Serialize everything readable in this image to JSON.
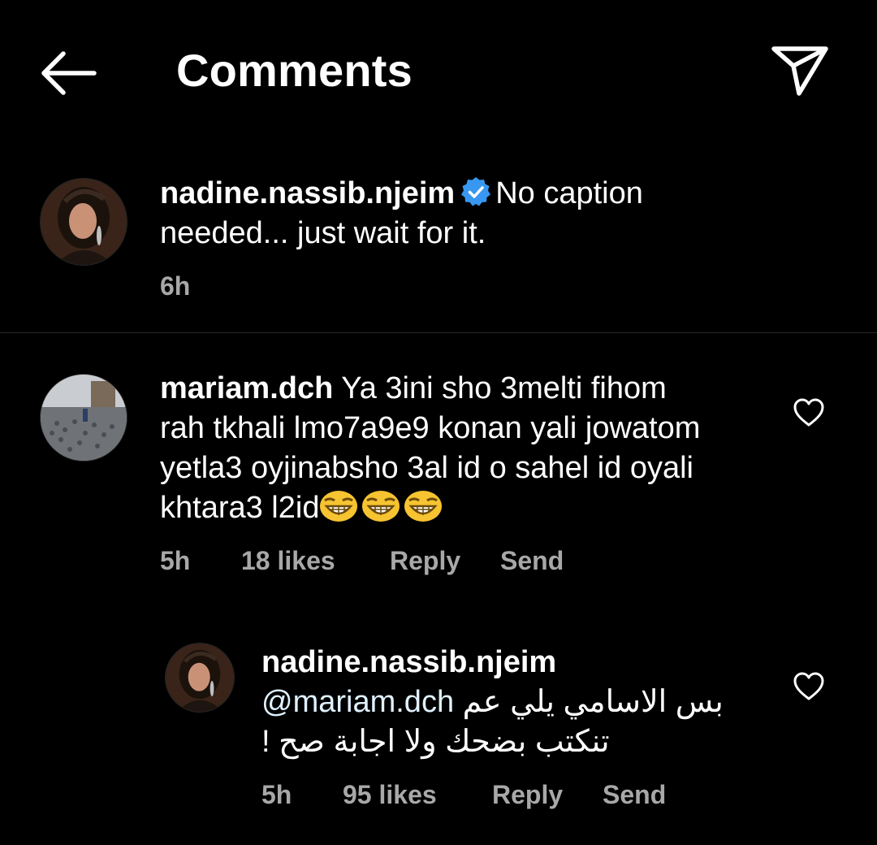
{
  "header": {
    "title": "Comments",
    "back_icon": "arrow-left-icon",
    "share_icon": "paper-plane-icon"
  },
  "caption": {
    "username": "nadine.nassib.njeim",
    "verified": true,
    "text_line1": "No caption",
    "text_line2": "needed... just wait for it.",
    "time": "6h"
  },
  "comments": [
    {
      "username": "mariam.dch",
      "text_line1": "Ya 3ini sho 3melti fihom",
      "text_line2": "rah tkhali lmo7a9e9 konan yali jowatom",
      "text_line3": "yetla3 oyjinabsho 3al id o sahel id oyali",
      "text_line4": "khtara3 l2id",
      "emoji": "😂😂😂",
      "time": "5h",
      "likes": "18 likes",
      "reply_label": "Reply",
      "send_label": "Send"
    }
  ],
  "reply": {
    "username": "nadine.nassib.njeim",
    "mention": "@mariam.dch",
    "text_line1_arabic": "بس الاسامي يلي عم",
    "text_line2_arabic": "تنكتب بضحك ولا اجابة صح !",
    "time": "5h",
    "likes": "95 likes",
    "reply_label": "Reply",
    "send_label": "Send"
  },
  "colors": {
    "background": "#000000",
    "text": "#ffffff",
    "secondary_text": "#a8a8a8",
    "verified_badge": "#3897f0",
    "divider": "#262626"
  }
}
